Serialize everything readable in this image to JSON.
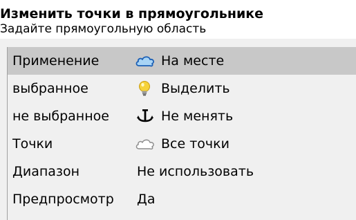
{
  "header": {
    "title": "Изменить точки в прямоугольнике",
    "subtitle": "Задайте прямоугольную область"
  },
  "rows": [
    {
      "label": "Применение",
      "value": "На месте",
      "icon": "cloud-blue-icon",
      "selected": true
    },
    {
      "label": "выбранное",
      "value": "Выделить",
      "icon": "lightbulb-icon",
      "selected": false
    },
    {
      "label": "не выбранное",
      "value": "Не менять",
      "icon": "anchor-icon",
      "selected": false
    },
    {
      "label": "Точки",
      "value": "Все точки",
      "icon": "cloud-outline-icon",
      "selected": false
    },
    {
      "label": "Диапазон",
      "value": "Не использовать",
      "icon": "",
      "selected": false
    },
    {
      "label": "Предпросмотр",
      "value": "Да",
      "icon": "",
      "selected": false
    }
  ],
  "colors": {
    "selected_row": "#c8c8c8",
    "cloud_fill": "#a8d4f5",
    "cloud_stroke": "#1b5fb5",
    "bulb_fill": "#f6d23a"
  }
}
